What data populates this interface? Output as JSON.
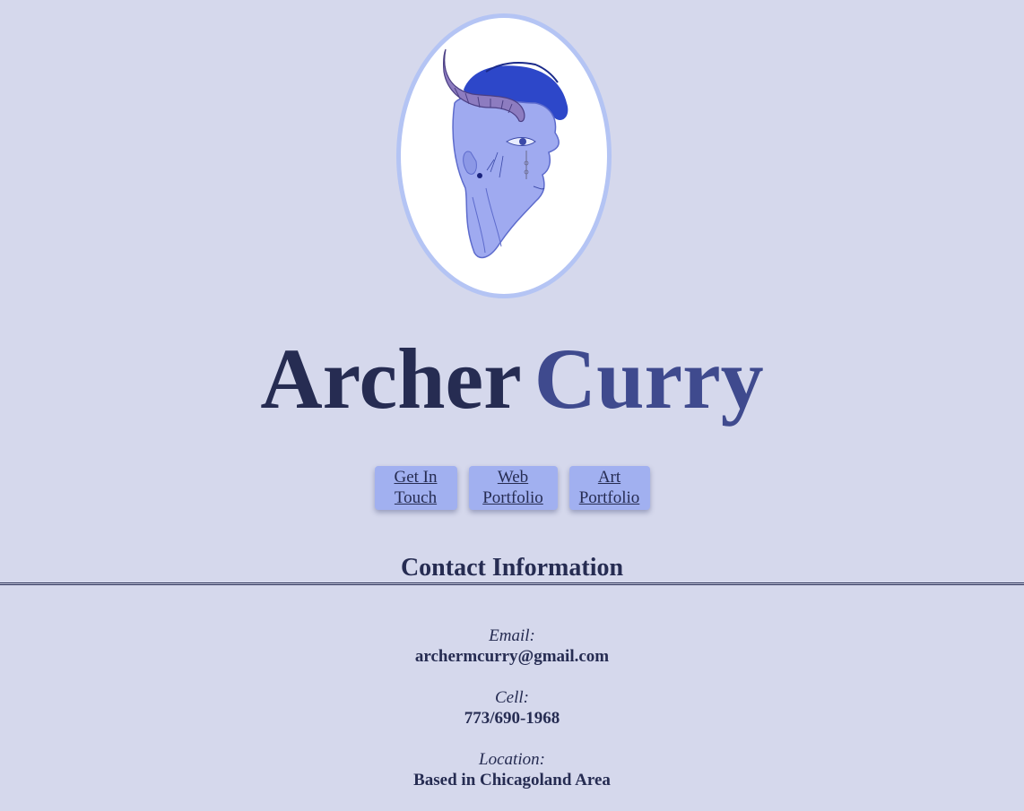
{
  "profile": {
    "image_alt": "Portrait illustration of a person with a horn"
  },
  "header": {
    "first_name": "Archer",
    "last_name": "Curry"
  },
  "nav": {
    "buttons": [
      {
        "line1": "Get In",
        "line2": "Touch"
      },
      {
        "line1": "Web",
        "line2": "Portfolio"
      },
      {
        "line1": "Art",
        "line2": "Portfolio"
      }
    ]
  },
  "contact": {
    "heading": "Contact Information",
    "items": [
      {
        "label": "Email:",
        "value": "archermcurry@gmail.com"
      },
      {
        "label": "Cell:",
        "value": "773/690-1968"
      },
      {
        "label": "Location:",
        "value": "Based in Chicagoland Area"
      }
    ]
  },
  "colors": {
    "background": "#d5d8ec",
    "frame_border": "#b4c4f4",
    "button_bg": "#a1b0f0",
    "text_dark": "#262c52",
    "accent": "#3f4a8e"
  }
}
